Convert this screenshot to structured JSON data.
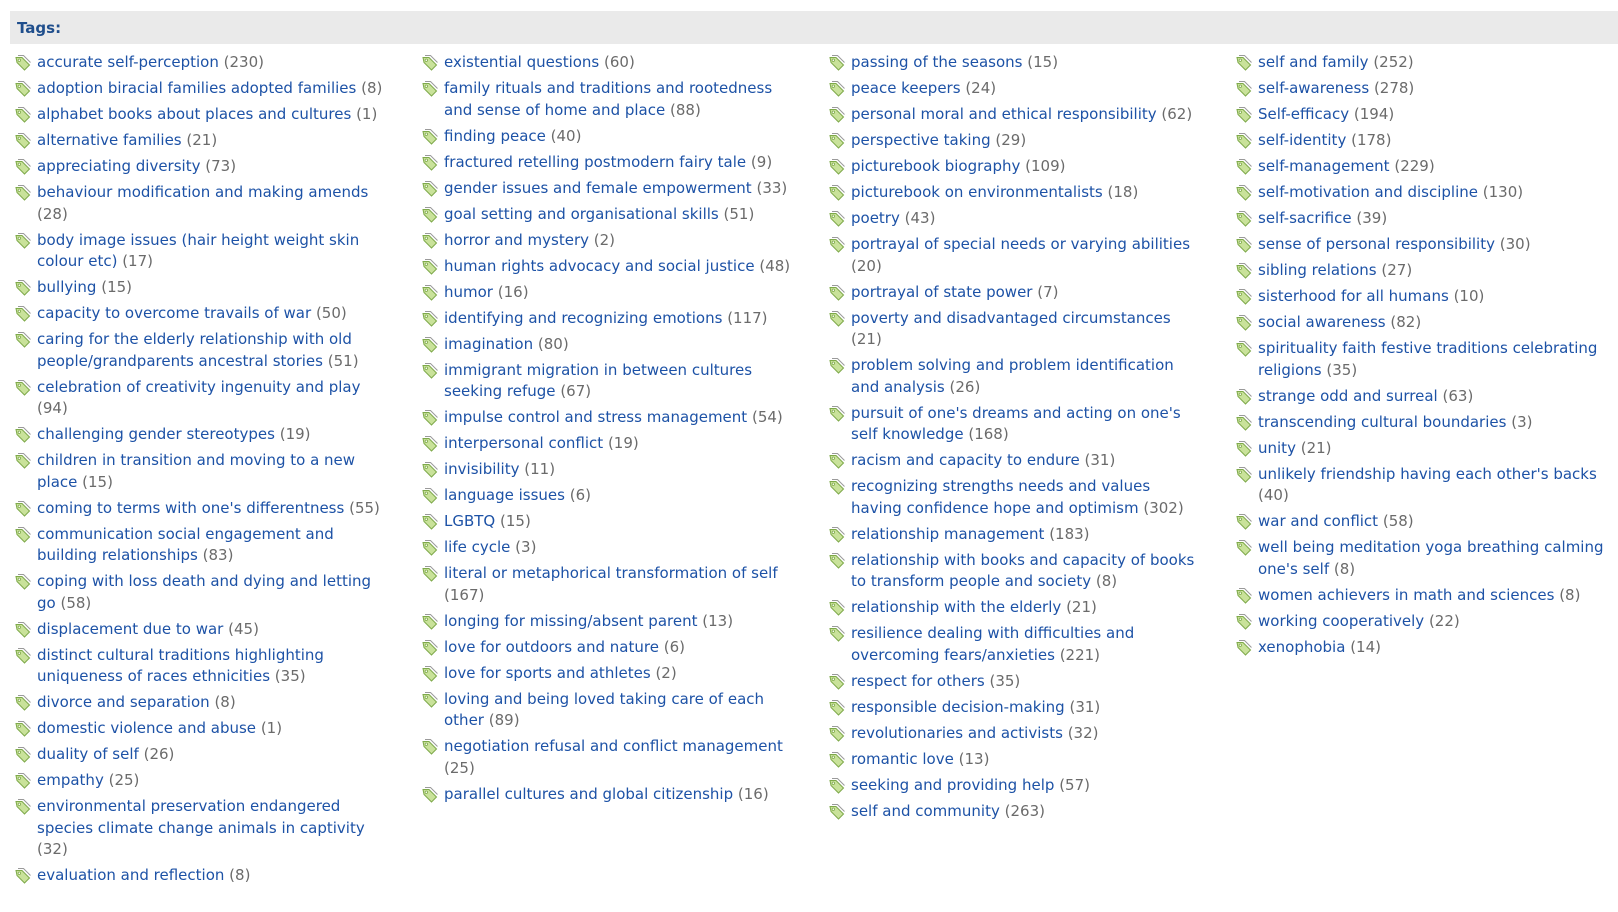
{
  "header": {
    "label": "Tags:"
  },
  "icon": "tag-icon",
  "colors": {
    "link": "#1d52a6",
    "count": "#6b6b6b",
    "header_bg": "#eaeaea",
    "header_text": "#1f4e8c",
    "icon_green": "#8cc63f"
  },
  "columns": [
    [
      {
        "label": "accurate self-perception",
        "count": "(230)"
      },
      {
        "label": "adoption biracial families adopted families",
        "count": "(8)"
      },
      {
        "label": "alphabet books about places and cultures",
        "count": "(1)"
      },
      {
        "label": "alternative families",
        "count": "(21)"
      },
      {
        "label": "appreciating diversity",
        "count": "(73)"
      },
      {
        "label": "behaviour modification and making amends",
        "count": "(28)"
      },
      {
        "label": "body image issues (hair height weight skin colour etc)",
        "count": "(17)"
      },
      {
        "label": "bullying",
        "count": "(15)"
      },
      {
        "label": "capacity to overcome travails of war",
        "count": "(50)"
      },
      {
        "label": "caring for the elderly relationship with old people/grandparents ancestral stories",
        "count": "(51)"
      },
      {
        "label": "celebration of creativity ingenuity and play",
        "count": "(94)"
      },
      {
        "label": "challenging gender stereotypes",
        "count": "(19)"
      },
      {
        "label": "children in transition and moving to a new place",
        "count": "(15)"
      },
      {
        "label": "coming to terms with one's differentness",
        "count": "(55)"
      },
      {
        "label": "communication social engagement and building relationships",
        "count": "(83)"
      },
      {
        "label": "coping with loss death and dying and letting go",
        "count": "(58)"
      },
      {
        "label": "displacement due to war",
        "count": "(45)"
      },
      {
        "label": "distinct cultural traditions highlighting uniqueness of races ethnicities",
        "count": "(35)"
      },
      {
        "label": "divorce and separation",
        "count": "(8)"
      },
      {
        "label": "domestic violence and abuse",
        "count": "(1)"
      },
      {
        "label": "duality of self",
        "count": "(26)"
      },
      {
        "label": "empathy",
        "count": "(25)"
      },
      {
        "label": "environmental preservation endangered species climate change animals in captivity",
        "count": "(32)"
      },
      {
        "label": "evaluation and reflection",
        "count": "(8)"
      }
    ],
    [
      {
        "label": "existential questions",
        "count": "(60)"
      },
      {
        "label": "family rituals and traditions and rootedness and sense of home and place",
        "count": "(88)"
      },
      {
        "label": "finding peace",
        "count": "(40)"
      },
      {
        "label": "fractured retelling postmodern fairy tale",
        "count": "(9)"
      },
      {
        "label": "gender issues and female empowerment",
        "count": "(33)"
      },
      {
        "label": "goal setting and organisational skills",
        "count": "(51)"
      },
      {
        "label": "horror and mystery",
        "count": "(2)"
      },
      {
        "label": "human rights advocacy and social justice",
        "count": "(48)"
      },
      {
        "label": "humor",
        "count": "(16)"
      },
      {
        "label": "identifying and recognizing emotions",
        "count": "(117)"
      },
      {
        "label": "imagination",
        "count": "(80)"
      },
      {
        "label": "immigrant migration in between cultures seeking refuge",
        "count": "(67)"
      },
      {
        "label": "impulse control and stress management",
        "count": "(54)"
      },
      {
        "label": "interpersonal conflict",
        "count": "(19)"
      },
      {
        "label": "invisibility",
        "count": "(11)"
      },
      {
        "label": "language issues",
        "count": "(6)"
      },
      {
        "label": "LGBTQ",
        "count": "(15)"
      },
      {
        "label": "life cycle",
        "count": "(3)"
      },
      {
        "label": "literal or metaphorical transformation of self",
        "count": "(167)"
      },
      {
        "label": "longing for missing/absent parent",
        "count": "(13)"
      },
      {
        "label": "love for outdoors and nature",
        "count": "(6)"
      },
      {
        "label": "love for sports and athletes",
        "count": "(2)"
      },
      {
        "label": "loving and being loved taking care of each other",
        "count": "(89)"
      },
      {
        "label": "negotiation refusal and conflict management",
        "count": "(25)"
      },
      {
        "label": "parallel cultures and global citizenship",
        "count": "(16)"
      }
    ],
    [
      {
        "label": "passing of the seasons",
        "count": "(15)"
      },
      {
        "label": "peace keepers",
        "count": "(24)"
      },
      {
        "label": "personal moral and ethical responsibility",
        "count": "(62)"
      },
      {
        "label": "perspective taking",
        "count": "(29)"
      },
      {
        "label": "picturebook biography",
        "count": "(109)"
      },
      {
        "label": "picturebook on environmentalists",
        "count": "(18)"
      },
      {
        "label": "poetry",
        "count": "(43)"
      },
      {
        "label": "portrayal of special needs or varying abilities",
        "count": "(20)"
      },
      {
        "label": "portrayal of state power",
        "count": "(7)"
      },
      {
        "label": "poverty and disadvantaged circumstances",
        "count": "(21)"
      },
      {
        "label": "problem solving and problem identification and analysis",
        "count": "(26)"
      },
      {
        "label": "pursuit of one's dreams and acting on one's self knowledge",
        "count": "(168)"
      },
      {
        "label": "racism and capacity to endure",
        "count": "(31)"
      },
      {
        "label": "recognizing strengths needs and values having confidence hope and optimism",
        "count": "(302)"
      },
      {
        "label": "relationship management",
        "count": "(183)"
      },
      {
        "label": "relationship with books and capacity of books to transform people and society",
        "count": "(8)"
      },
      {
        "label": "relationship with the elderly",
        "count": "(21)"
      },
      {
        "label": "resilience dealing with difficulties and overcoming fears/anxieties",
        "count": "(221)"
      },
      {
        "label": "respect for others",
        "count": "(35)"
      },
      {
        "label": "responsible decision-making",
        "count": "(31)"
      },
      {
        "label": "revolutionaries and activists",
        "count": "(32)"
      },
      {
        "label": "romantic love",
        "count": "(13)"
      },
      {
        "label": "seeking and providing help",
        "count": "(57)"
      },
      {
        "label": "self and community",
        "count": "(263)"
      }
    ],
    [
      {
        "label": "self and family",
        "count": "(252)"
      },
      {
        "label": "self-awareness",
        "count": "(278)"
      },
      {
        "label": "Self-efficacy",
        "count": "(194)"
      },
      {
        "label": "self-identity",
        "count": "(178)"
      },
      {
        "label": "self-management",
        "count": "(229)"
      },
      {
        "label": "self-motivation and discipline",
        "count": "(130)"
      },
      {
        "label": "self-sacrifice",
        "count": "(39)"
      },
      {
        "label": "sense of personal responsibility",
        "count": "(30)"
      },
      {
        "label": "sibling relations",
        "count": "(27)"
      },
      {
        "label": "sisterhood for all humans",
        "count": "(10)"
      },
      {
        "label": "social awareness",
        "count": "(82)"
      },
      {
        "label": "spirituality faith festive traditions celebrating religions",
        "count": "(35)"
      },
      {
        "label": "strange odd and surreal",
        "count": "(63)"
      },
      {
        "label": "transcending cultural boundaries",
        "count": "(3)"
      },
      {
        "label": "unity",
        "count": "(21)"
      },
      {
        "label": "unlikely friendship having each other's backs",
        "count": "(40)"
      },
      {
        "label": "war and conflict",
        "count": "(58)"
      },
      {
        "label": "well being meditation yoga breathing calming one's self",
        "count": "(8)"
      },
      {
        "label": "women achievers in math and sciences",
        "count": "(8)"
      },
      {
        "label": "working cooperatively",
        "count": "(22)"
      },
      {
        "label": "xenophobia",
        "count": "(14)"
      }
    ]
  ]
}
